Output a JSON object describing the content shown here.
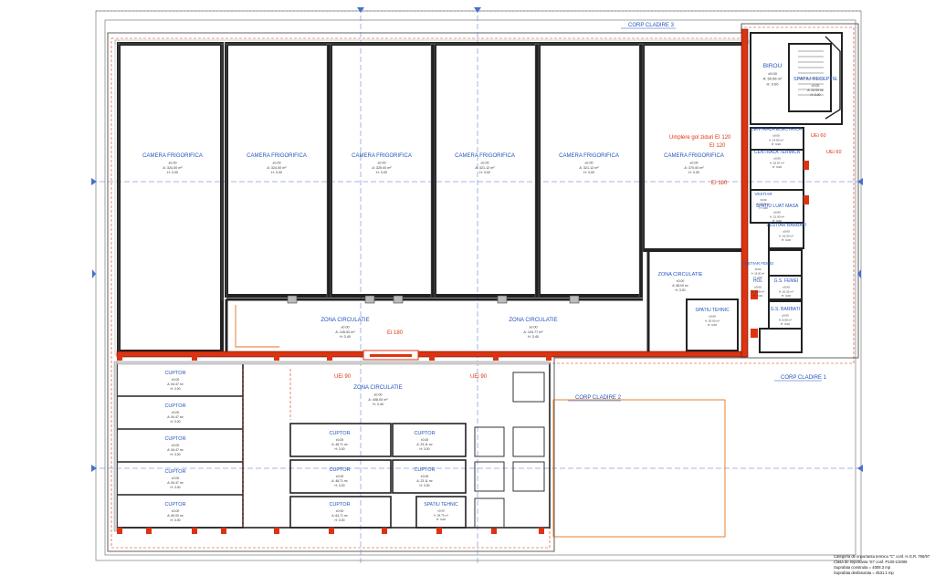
{
  "colors": {
    "wall": "#222222",
    "fire_wall": "#dd3311",
    "room_label": "#2255bb",
    "axis": "#4a6fd0",
    "dim": "#666666"
  },
  "buildings": {
    "corp_1": "CORP CLADIRE 1",
    "corp_2": "CORP CLADIRE 2",
    "corp_3": "CORP CLADIRE 3"
  },
  "fire_notes": {
    "umplere": "Umplere gol ziduri EI 120",
    "ei120": "EI 120",
    "ei180_a": "EI 180",
    "ei180_b": "Ei 180",
    "uei60_a": "UEi 60",
    "uei60_b": "UEi 60",
    "uei90_a": "UEi 90",
    "uei90_b": "UEi 90"
  },
  "rooms": {
    "camera_1": {
      "name": "CAMERA FRIGORIFICA",
      "level": "±0.00",
      "area": "A: 324.00 m²",
      "height": "H: 3.00"
    },
    "camera_2": {
      "name": "CAMERA FRIGORIFICA",
      "level": "±0.00",
      "area": "A: 324.00 m²",
      "height": "H: 3.00"
    },
    "camera_3": {
      "name": "CAMERA FRIGORIFICA",
      "level": "±0.00",
      "area": "A: 325.00 m²",
      "height": "H: 3.00"
    },
    "camera_4": {
      "name": "CAMERA FRIGORIFICA",
      "level": "±0.00",
      "area": "A: 321.12 m²",
      "height": "H: 3.00"
    },
    "camera_5": {
      "name": "CAMERA FRIGORIFICA",
      "level": "±0.00",
      "area": "A: 321.12 m²",
      "height": "H: 3.00"
    },
    "camera_6": {
      "name": "CAMERA FRIGORIFICA",
      "level": "±0.00",
      "area": "A: 370.00 m²",
      "height": "H: 3.00"
    },
    "birou": {
      "name": "BIROU",
      "level": "±0.00",
      "area": "A: 50.56 m²",
      "height": "H: 3.00"
    },
    "spatiu_receptie": {
      "name": "SPATIU RECEPTIE",
      "level": "±0.00",
      "area": "A: 24.00 m²",
      "height": "H: 3.00"
    },
    "centrala_electrica": {
      "name": "CENTRALA ELECTRICA",
      "level": "±0.00",
      "area": "A: 14.00 m²",
      "height": "H: 3.00"
    },
    "centrala_termica": {
      "name": "CENTRALA TERMICA",
      "level": "±0.00",
      "area": "A: 15.67 m²",
      "height": "H: 3.00"
    },
    "vestiar": {
      "name": "VESTIAR",
      "level": "±0.00",
      "area": "A: 10.32 m²",
      "height": "H: 3.00"
    },
    "spatiu_luat_masa": {
      "name": "SPATIU LUAT MASA",
      "level": "±0.00",
      "area": "A: 21.00 m²",
      "height": "H: 3.00"
    },
    "vestiar_barbati": {
      "name": "VESTIAR BARBATI",
      "level": "±0.00",
      "area": "A: 16.20 m²",
      "height": "H: 3.00"
    },
    "vestiar_femei": {
      "name": "VESTIAR FEMEI",
      "level": "±0.00",
      "area": "A: 16.20 m²",
      "height": "H: 3.00"
    },
    "hol": {
      "name": "HOL",
      "level": "±0.00",
      "area": "A: 8.88 m²",
      "height": "H: 3.00"
    },
    "gs_femei": {
      "name": "G.S. FEMEI",
      "level": "±0.00",
      "area": "A: 10.32 m²",
      "height": "H: 3.00"
    },
    "gs_barbati": {
      "name": "G.S. BARBATI",
      "level": "±0.00",
      "area": "A: 8.50 m²",
      "height": "H: 3.00"
    },
    "zona_circ_small": {
      "name": "ZONA CIRCULATIE",
      "level": "±0.00",
      "area": "A: 58.00 m²",
      "height": "H: 3.00"
    },
    "spatiu_tehnic_1": {
      "name": "SPATIU TEHNIC",
      "level": "±0.00",
      "area": "A: 20.00 m²",
      "height": "H: 3.00"
    },
    "zona_circ_left": {
      "name": "ZONA CIRCULATIE",
      "level": "±0.00",
      "area": "A: 126.00 m²",
      "height": "H: 3.40"
    },
    "zona_circ_right": {
      "name": "ZONA CIRCULATIE",
      "level": "±0.00",
      "area": "A: 104.77 m²",
      "height": "H: 3.40"
    },
    "zona_circ_bottom": {
      "name": "ZONA CIRCULATIE",
      "level": "±0.00",
      "area": "A: 408.00 m²",
      "height": "H: 3.40"
    },
    "cuptor_l1": {
      "name": "CUPTOR",
      "level": "±0.00",
      "area": "A: 54.47 m²",
      "height": "H: 3.00"
    },
    "cuptor_l2": {
      "name": "CUPTOR",
      "level": "±0.00",
      "area": "A: 54.47 m²",
      "height": "H: 3.00"
    },
    "cuptor_l3": {
      "name": "CUPTOR",
      "level": "±0.00",
      "area": "A: 54.47 m²",
      "height": "H: 3.00"
    },
    "cuptor_l4": {
      "name": "CUPTOR",
      "level": "±0.00",
      "area": "A: 54.47 m²",
      "height": "H: 3.00"
    },
    "cuptor_l5": {
      "name": "CUPTOR",
      "level": "±0.00",
      "area": "A: 60.00 m²",
      "height": "H: 3.00"
    },
    "cuptor_c1": {
      "name": "CUPTOR",
      "level": "±0.00",
      "area": "A: 48.71 m²",
      "height": "H: 3.00"
    },
    "cuptor_c2": {
      "name": "CUPTOR",
      "level": "±0.00",
      "area": "A: 48.71 m²",
      "height": "H: 3.00"
    },
    "cuptor_c3": {
      "name": "CUPTOR",
      "level": "±0.00",
      "area": "A: 64.71 m²",
      "height": "H: 3.00"
    },
    "cuptor_r1": {
      "name": "CUPTOR",
      "level": "±0.00",
      "area": "A: 23.11 m²",
      "height": "H: 3.00"
    },
    "cuptor_r2": {
      "name": "CUPTOR",
      "level": "±0.00",
      "area": "A: 23.11 m²",
      "height": "H: 3.00"
    },
    "spatiu_tehnic_2": {
      "name": "SPATIU TEHNIC",
      "level": "±0.00",
      "area": "A: 28.75 m²",
      "height": "H: 3.00"
    }
  },
  "legend": {
    "line1": "Categoria de importanta termica \"C\" conf. H.G.R. 766/97",
    "line2": "Clasa de importanta \"III\" conf. P100-1/2006",
    "line3": "Suprafata construita = 4008.3 mp",
    "line4": "Suprafata desfasurata = 4531.1 mp"
  }
}
